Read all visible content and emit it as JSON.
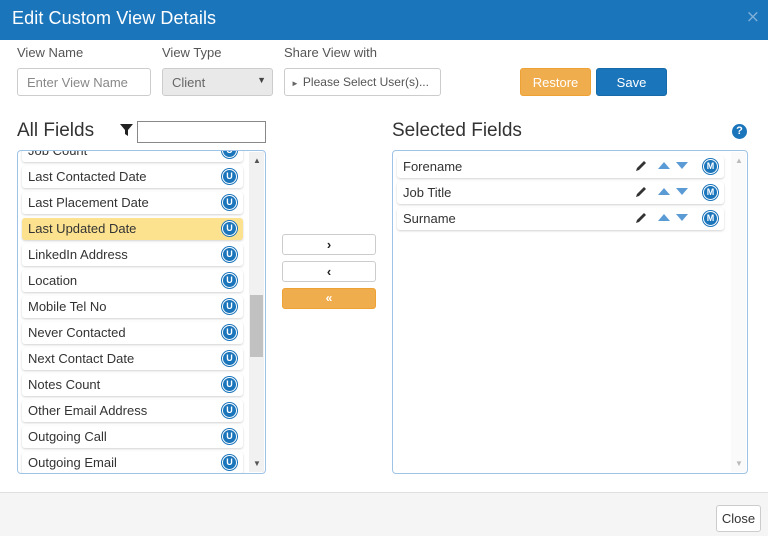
{
  "dialog": {
    "title": "Edit Custom View Details",
    "close_glyph": "×"
  },
  "form": {
    "view_name_label": "View Name",
    "view_name_placeholder": "Enter View Name",
    "view_type_label": "View Type",
    "view_type_value": "Client",
    "share_label": "Share View with",
    "share_placeholder": "Please Select User(s)..."
  },
  "buttons": {
    "restore": "Restore",
    "save": "Save",
    "close": "Close",
    "move_right": "›",
    "move_left": "‹",
    "move_all_left": "«"
  },
  "all_fields": {
    "title": "All Fields",
    "filter_value": "",
    "items": [
      {
        "label": "Job Count",
        "badge": "U"
      },
      {
        "label": "Last Contacted Date",
        "badge": "U"
      },
      {
        "label": "Last Placement Date",
        "badge": "U"
      },
      {
        "label": "Last Updated Date",
        "badge": "U",
        "selected": true
      },
      {
        "label": "LinkedIn Address",
        "badge": "U"
      },
      {
        "label": "Location",
        "badge": "U"
      },
      {
        "label": "Mobile Tel No",
        "badge": "U"
      },
      {
        "label": "Never Contacted",
        "badge": "U"
      },
      {
        "label": "Next Contact Date",
        "badge": "U"
      },
      {
        "label": "Notes Count",
        "badge": "U"
      },
      {
        "label": "Other Email Address",
        "badge": "U"
      },
      {
        "label": "Outgoing Call",
        "badge": "U"
      },
      {
        "label": "Outgoing Email",
        "badge": "U"
      }
    ]
  },
  "selected_fields": {
    "title": "Selected Fields",
    "help_glyph": "?",
    "items": [
      {
        "label": "Forename",
        "badge": "M"
      },
      {
        "label": "Job Title",
        "badge": "M"
      },
      {
        "label": "Surname",
        "badge": "M"
      }
    ]
  },
  "colors": {
    "primary": "#1b75bb",
    "warning": "#f0ad4e",
    "highlight": "#fce28f"
  }
}
